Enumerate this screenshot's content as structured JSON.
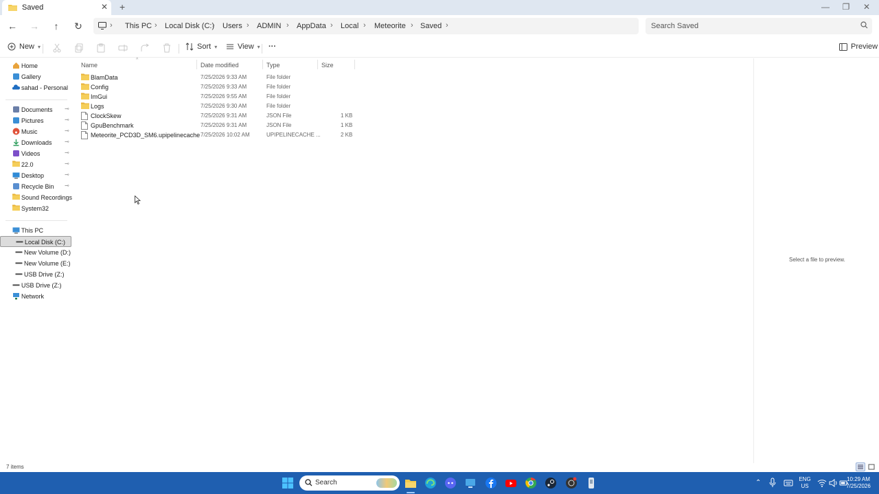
{
  "window": {
    "tab_title": "Saved",
    "new_tab": "+",
    "close_tab": "✕",
    "minimize": "—",
    "restore": "❐",
    "close": "✕"
  },
  "address": {
    "crumbs": [
      "This PC",
      "Local Disk (C:)",
      "Users",
      "ADMIN",
      "AppData",
      "Local",
      "Meteorite",
      "Saved"
    ],
    "search_placeholder": "Search Saved"
  },
  "toolbar": {
    "new_label": "New",
    "sort_label": "Sort",
    "view_label": "View",
    "more_label": "···",
    "preview_label": "Preview"
  },
  "sidebar": {
    "quick": [
      {
        "label": "Home",
        "icon": "home-icon",
        "color": "#e8a33c"
      },
      {
        "label": "Gallery",
        "icon": "gallery-icon",
        "color": "#3b8fd6"
      },
      {
        "label": "sahad - Personal",
        "icon": "onedrive-icon",
        "color": "#1f6ec2"
      }
    ],
    "pinned": [
      {
        "label": "Documents",
        "icon": "documents-icon",
        "color": "#6b7fa8",
        "pinned": true
      },
      {
        "label": "Pictures",
        "icon": "pictures-icon",
        "color": "#3b8fd6",
        "pinned": true
      },
      {
        "label": "Music",
        "icon": "music-icon",
        "color": "#e0533a",
        "pinned": true
      },
      {
        "label": "Downloads",
        "icon": "downloads-icon",
        "color": "#2e9e5e",
        "pinned": true
      },
      {
        "label": "Videos",
        "icon": "videos-icon",
        "color": "#7d4fc9",
        "pinned": true
      },
      {
        "label": "22.0",
        "icon": "folder-icon",
        "color": "#f2c94c",
        "pinned": true
      },
      {
        "label": "Desktop",
        "icon": "desktop-icon",
        "color": "#2f8ad6",
        "pinned": true
      },
      {
        "label": "Recycle Bin",
        "icon": "recycle-bin-icon",
        "color": "#5a8fd0",
        "pinned": true
      },
      {
        "label": "Sound Recordings",
        "icon": "folder-icon",
        "color": "#f2c94c",
        "pinned": false
      },
      {
        "label": "System32",
        "icon": "folder-icon",
        "color": "#f2c94c",
        "pinned": false
      }
    ],
    "pin_glyph": "📌",
    "devices": [
      {
        "label": "This PC",
        "icon": "this-pc-icon",
        "color": "#3b8fd6",
        "indent": 0
      },
      {
        "label": "Local Disk (C:)",
        "icon": "drive-icon",
        "color": "#4a4a4a",
        "indent": 1,
        "selected": true
      },
      {
        "label": "New Volume (D:)",
        "icon": "drive-icon",
        "color": "#4a4a4a",
        "indent": 1
      },
      {
        "label": "New Volume (E:)",
        "icon": "drive-icon",
        "color": "#4a4a4a",
        "indent": 1
      },
      {
        "label": "USB Drive (Z:)",
        "icon": "usb-drive-icon",
        "color": "#4a4a4a",
        "indent": 1
      },
      {
        "label": "USB Drive (Z:)",
        "icon": "usb-drive-icon",
        "color": "#4a4a4a",
        "indent": 0
      },
      {
        "label": "Network",
        "icon": "network-icon",
        "color": "#3b8fd6",
        "indent": 0
      }
    ]
  },
  "filelist": {
    "headers": {
      "name": "Name",
      "date": "Date modified",
      "type": "Type",
      "size": "Size"
    },
    "rows": [
      {
        "name": "BlamData",
        "date": "7/25/2026 9:33 AM",
        "type": "File folder",
        "size": "",
        "kind": "folder"
      },
      {
        "name": "Config",
        "date": "7/25/2026 9:33 AM",
        "type": "File folder",
        "size": "",
        "kind": "folder"
      },
      {
        "name": "ImGui",
        "date": "7/25/2026 9:55 AM",
        "type": "File folder",
        "size": "",
        "kind": "folder"
      },
      {
        "name": "Logs",
        "date": "7/25/2026 9:30 AM",
        "type": "File folder",
        "size": "",
        "kind": "folder"
      },
      {
        "name": "ClockSkew",
        "date": "7/25/2026 9:31 AM",
        "type": "JSON File",
        "size": "1 KB",
        "kind": "file"
      },
      {
        "name": "GpuBenchmark",
        "date": "7/25/2026 9:31 AM",
        "type": "JSON File",
        "size": "1 KB",
        "kind": "file"
      },
      {
        "name": "Meteorite_PCD3D_SM6.upipelinecache",
        "date": "7/25/2026 10:02 AM",
        "type": "UPIPELINECACHE ...",
        "size": "2 KB",
        "kind": "file"
      }
    ]
  },
  "preview": {
    "message": "Select a file to preview."
  },
  "status": {
    "item_count": "7 items"
  },
  "taskbar": {
    "search_label": "Search",
    "lang_top": "ENG",
    "lang_bottom": "US",
    "time": "10:29 AM",
    "date": "7/25/2026",
    "colors": {
      "bar": "#1f5fb0",
      "accent": "#0078d4"
    }
  }
}
